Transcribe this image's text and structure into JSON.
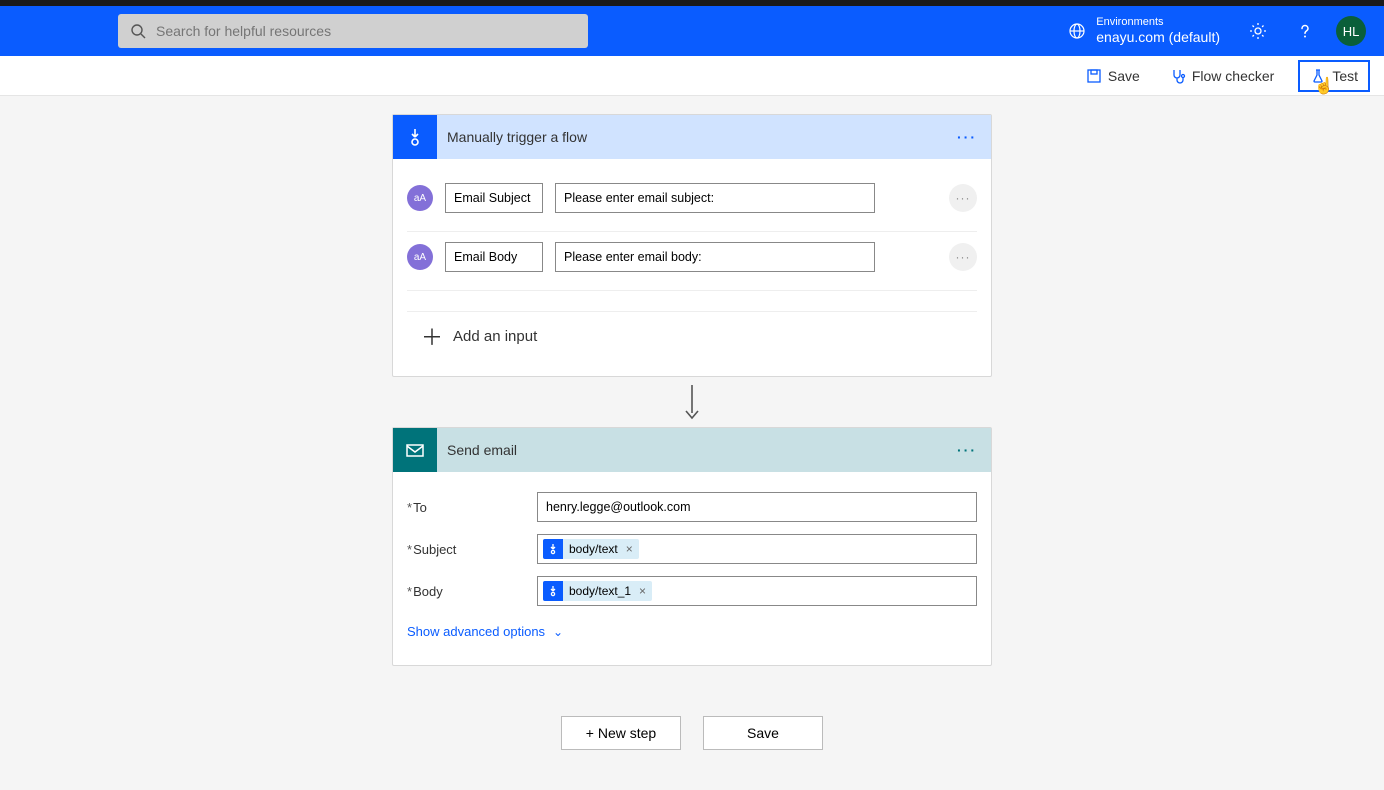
{
  "header": {
    "search_placeholder": "Search for helpful resources",
    "env_label": "Environments",
    "env_name": "enayu.com (default)",
    "avatar_initials": "HL"
  },
  "toolbar": {
    "save_label": "Save",
    "checker_label": "Flow checker",
    "test_label": "Test"
  },
  "trigger": {
    "title": "Manually trigger a flow",
    "inputs": [
      {
        "type_badge": "aA",
        "name": "Email Subject",
        "prompt": "Please enter email subject:"
      },
      {
        "type_badge": "aA",
        "name": "Email Body",
        "prompt": "Please enter email body:"
      }
    ],
    "add_input_label": "Add an input"
  },
  "email": {
    "title": "Send email",
    "to_label": "To",
    "to_value": "henry.legge@outlook.com",
    "subject_label": "Subject",
    "subject_token": "body/text",
    "body_label": "Body",
    "body_token": "body/text_1",
    "advanced_label": "Show advanced options"
  },
  "footer": {
    "new_step_label": "+ New step",
    "save_label": "Save"
  }
}
